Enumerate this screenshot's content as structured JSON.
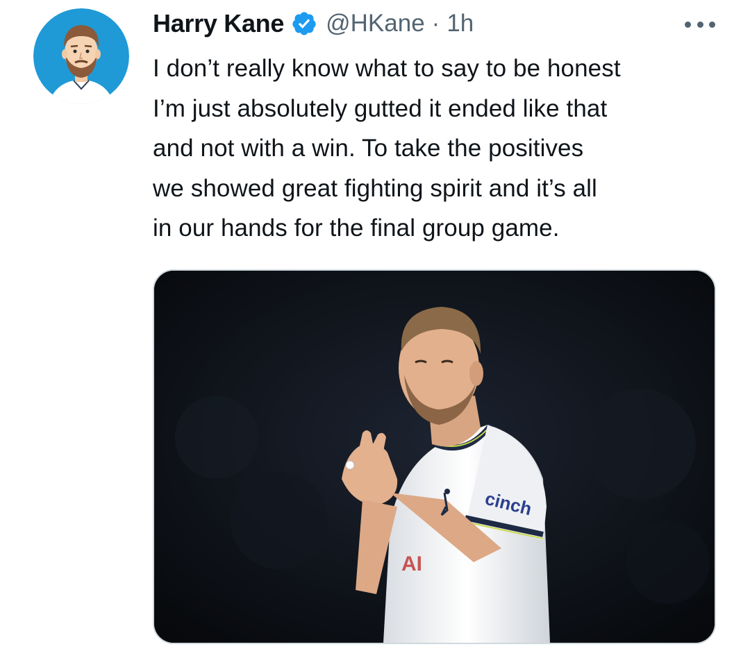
{
  "tweet": {
    "display_name": "Harry Kane",
    "handle": "@HKane",
    "separator": "·",
    "time": "1h",
    "verified_icon": "verified-badge-icon",
    "more_icon": "more-horizontal-icon",
    "text_lines": [
      "I don’t really know what to say to be honest",
      "I’m just absolutely gutted it ended like that",
      "and not with a win. To take the positives",
      "we showed great fighting spirit and it’s all",
      "in our hands for the final group game."
    ],
    "photo_jersey_sponsor": "cinch",
    "photo_sleeve_lettering": "AI"
  },
  "colors": {
    "verified_blue": "#1d9bf0",
    "secondary_text": "#536471",
    "primary_text": "#0f1419",
    "avatar_background": "#1f9ad6",
    "media_border": "#cfd9de"
  }
}
